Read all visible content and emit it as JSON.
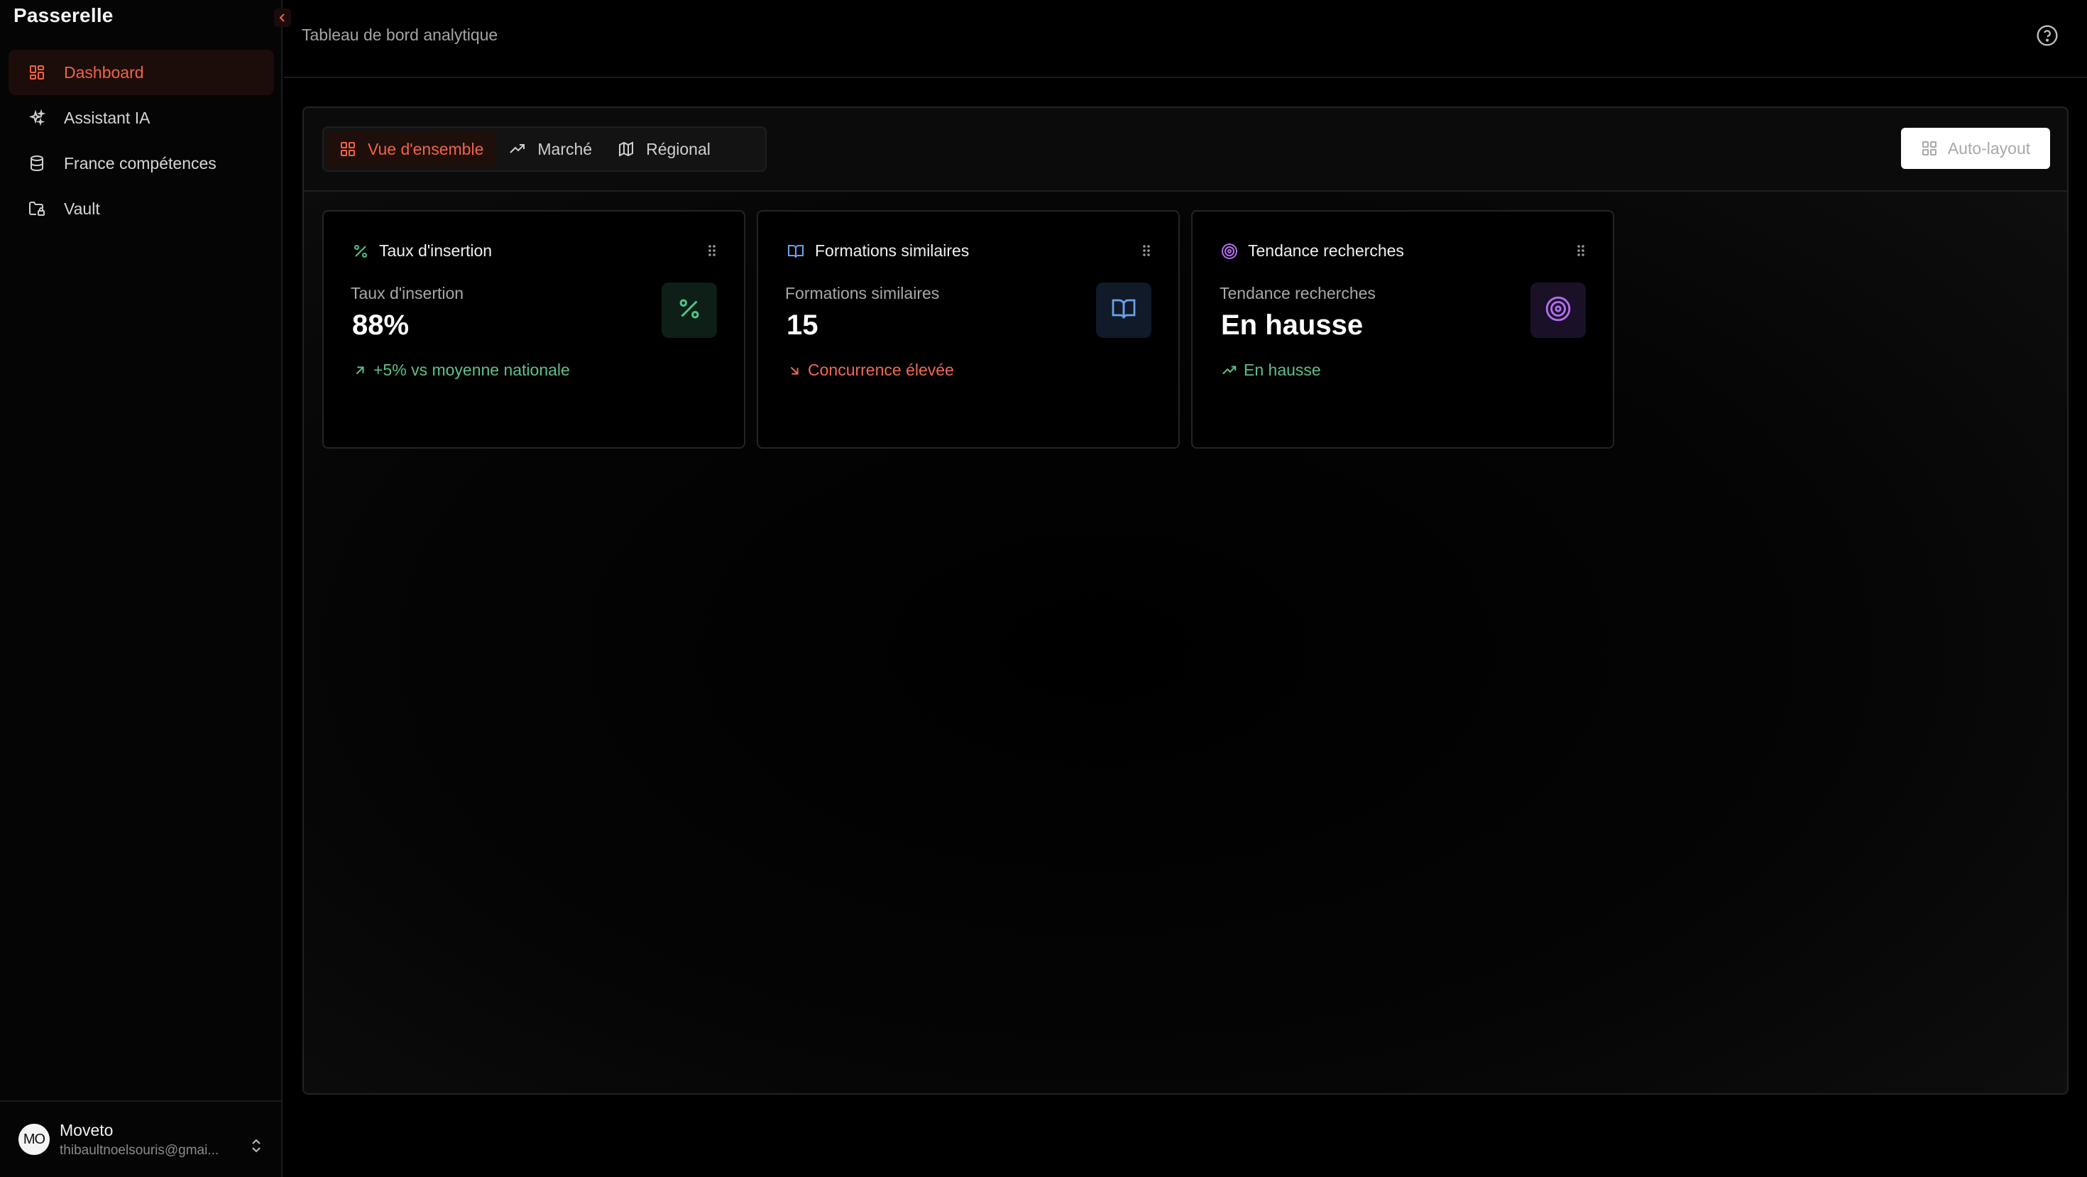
{
  "app": {
    "brand": "Passerelle"
  },
  "sidebar": {
    "items": [
      {
        "label": "Dashboard",
        "icon": "dashboard-grid-icon",
        "active": true
      },
      {
        "label": "Assistant IA",
        "icon": "sparkles-icon",
        "active": false
      },
      {
        "label": "France compétences",
        "icon": "database-icon",
        "active": false
      },
      {
        "label": "Vault",
        "icon": "folder-lock-icon",
        "active": false
      }
    ]
  },
  "user": {
    "initials": "MO",
    "name": "Moveto",
    "email": "thibaultnoelsouris@gmai..."
  },
  "header": {
    "title": "Tableau de bord analytique",
    "help_icon": "help-circle-icon"
  },
  "toolbar": {
    "tabs": [
      {
        "label": "Vue d'ensemble",
        "icon": "layout-grid-icon",
        "active": true
      },
      {
        "label": "Marché",
        "icon": "trending-up-icon",
        "active": false
      },
      {
        "label": "Régional",
        "icon": "map-icon",
        "active": false
      }
    ],
    "auto_layout_label": "Auto-layout"
  },
  "cards": [
    {
      "title": "Taux d'insertion",
      "metric_label": "Taux d'insertion",
      "value": "88%",
      "trend": "+5% vs moyenne nationale",
      "trend_color": "#5fbf8a",
      "icon": "percent-icon",
      "accent": "#4fc58a"
    },
    {
      "title": "Formations similaires",
      "metric_label": "Formations similaires",
      "value": "15",
      "trend": "Concurrence élevée",
      "trend_color": "#ee6a55",
      "icon": "book-open-icon",
      "accent": "#6aa3ea"
    },
    {
      "title": "Tendance recherches",
      "metric_label": "Tendance recherches",
      "value": "En hausse",
      "trend": "En hausse",
      "trend_color": "#5fbf8a",
      "icon": "target-icon",
      "accent": "#b56ef0"
    }
  ],
  "colors": {
    "accent": "#f06345",
    "background": "#000000"
  }
}
